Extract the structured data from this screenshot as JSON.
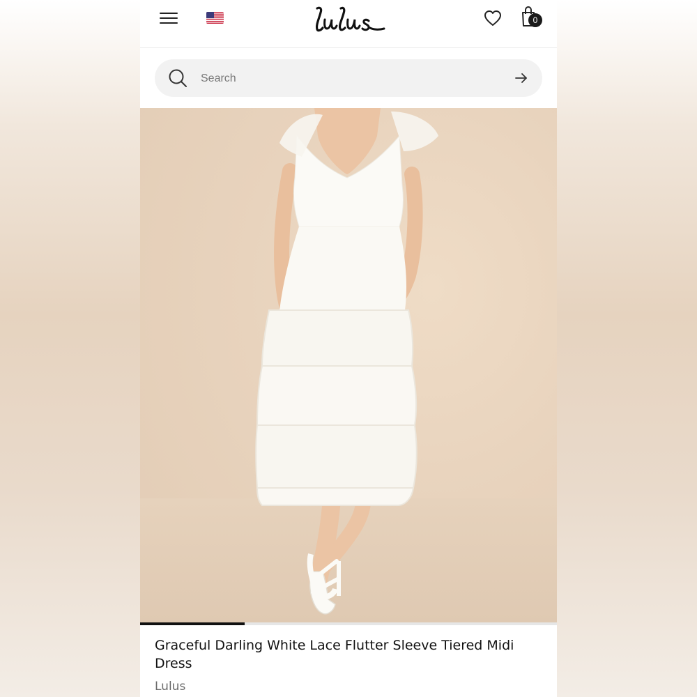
{
  "header": {
    "brand": "Lulus",
    "locale_flag": "us-flag",
    "cart_count": "0",
    "icons": {
      "menu": "hamburger-menu-icon",
      "wishlist": "heart-icon",
      "cart": "shopping-bag-icon"
    }
  },
  "search": {
    "placeholder": "Search",
    "value": "",
    "icons": {
      "left": "search-icon",
      "right": "arrow-right-icon"
    }
  },
  "product": {
    "image_alt": "Model wearing a white lace flutter sleeve tiered midi dress with white strappy heels",
    "title": "Graceful Darling White Lace Flutter Sleeve Tiered Midi Dress",
    "brand": "Lulus",
    "gallery_progress": 0.25
  },
  "colors": {
    "accent": "#111111",
    "image_background": "#e8d3bd",
    "dress": "#fbfaf6"
  }
}
